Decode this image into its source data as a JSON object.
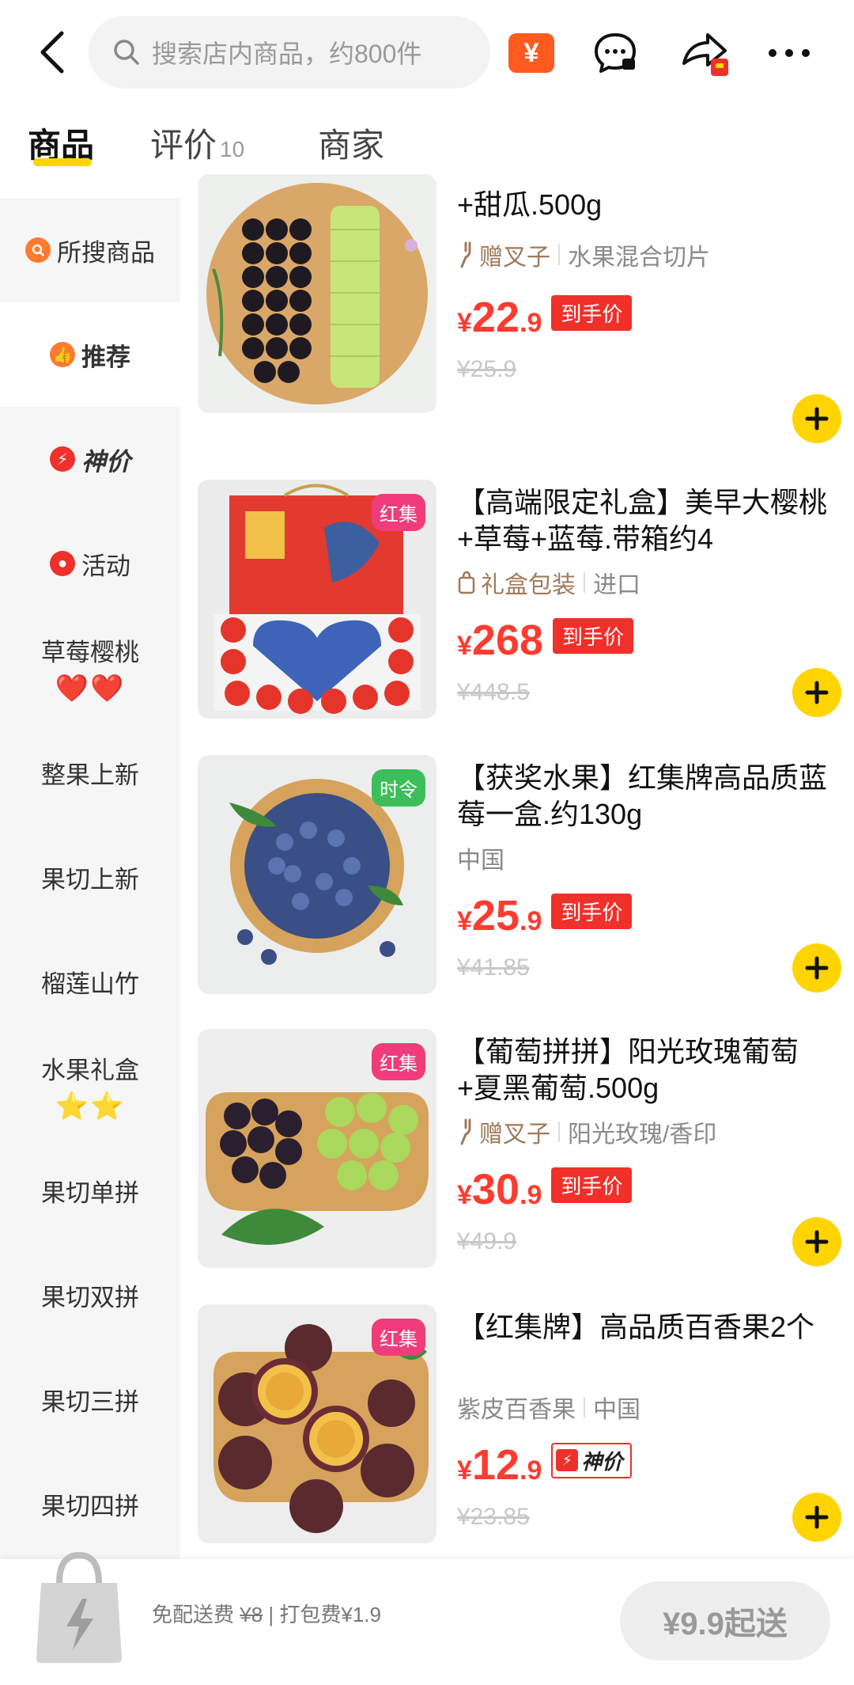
{
  "search": {
    "placeholder": "搜索店内商品，约800件"
  },
  "tabs": [
    {
      "label": "商品",
      "count": ""
    },
    {
      "label": "评价",
      "count": "10"
    },
    {
      "label": "商家",
      "count": ""
    }
  ],
  "section_title": "推荐",
  "sidebar": {
    "items": [
      {
        "label": "所搜商品",
        "icon": "search-icon"
      },
      {
        "label": "推荐",
        "icon": "thumbs-up-icon"
      },
      {
        "label": "神价",
        "icon": "lightning-icon"
      },
      {
        "label": "活动",
        "icon": "tag-icon"
      },
      {
        "label": "草莓樱桃",
        "deco": "❤️❤️"
      },
      {
        "label": "整果上新"
      },
      {
        "label": "果切上新"
      },
      {
        "label": "榴莲山竹"
      },
      {
        "label": "水果礼盒",
        "deco": "⭐⭐"
      },
      {
        "label": "果切单拼"
      },
      {
        "label": "果切双拼"
      },
      {
        "label": "果切三拼"
      },
      {
        "label": "果切四拼"
      }
    ]
  },
  "products": [
    {
      "title": "+甜瓜.500g",
      "meta_tag": "赠叉子",
      "meta_text": "水果混合切片",
      "price_symbol": "¥",
      "price_int": "22",
      "price_dec": ".9",
      "price_label": "到手价",
      "orig_price": "¥25.9",
      "badge": ""
    },
    {
      "title": "【高端限定礼盒】美早大樱桃+草莓+蓝莓.带箱约4",
      "meta_tag": "礼盒包装",
      "meta_text": "进口",
      "price_symbol": "¥",
      "price_int": "268",
      "price_dec": "",
      "price_label": "到手价",
      "orig_price": "¥448.5",
      "badge": "红集",
      "badge_color": "#f03c7a"
    },
    {
      "title": "【获奖水果】红集牌高品质蓝莓一盒.约130g",
      "meta_tag": "",
      "meta_text": "中国",
      "price_symbol": "¥",
      "price_int": "25",
      "price_dec": ".9",
      "price_label": "到手价",
      "orig_price": "¥41.85",
      "badge": "时令",
      "badge_color": "#3cbf5a"
    },
    {
      "title": "【葡萄拼拼】阳光玫瑰葡萄+夏黑葡萄.500g",
      "meta_tag": "赠叉子",
      "meta_text": "阳光玫瑰/香印",
      "price_symbol": "¥",
      "price_int": "30",
      "price_dec": ".9",
      "price_label": "到手价",
      "orig_price": "¥49.9",
      "badge": "红集",
      "badge_color": "#f03c7a"
    },
    {
      "title": "【红集牌】高品质百香果2个",
      "meta_tag": "",
      "meta_text_a": "紫皮百香果",
      "meta_text": "中国",
      "price_symbol": "¥",
      "price_int": "12",
      "price_dec": ".9",
      "price_label": "神价",
      "orig_price": "¥23.85",
      "badge": "红集",
      "badge_color": "#f03c7a"
    }
  ],
  "bottom": {
    "fee_prefix": "免配送费",
    "fee_strike": "¥8",
    "fee_pack": " | 打包费¥1.9",
    "cta": "¥9.9起送"
  },
  "colors": {
    "accent": "#ffd400",
    "price": "#ff3b30",
    "label_red": "#f0302a"
  }
}
